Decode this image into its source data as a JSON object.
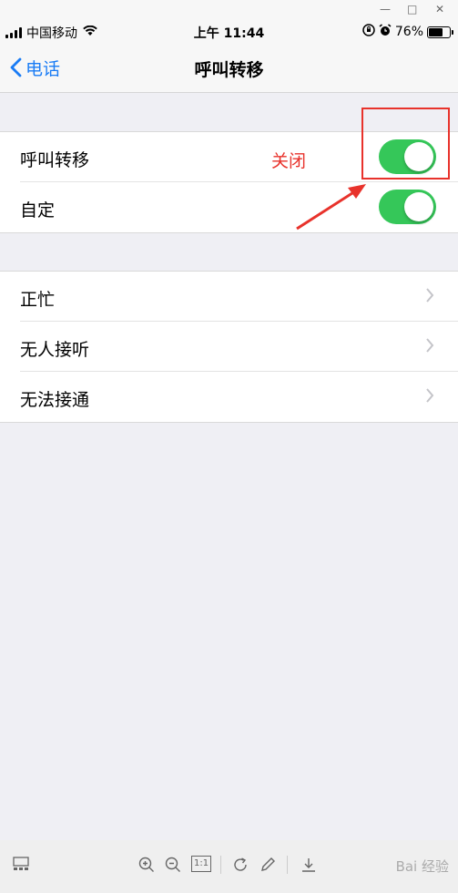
{
  "status_bar": {
    "carrier": "中国移动",
    "time": "上午 11:44",
    "battery": "76%",
    "battery_level": 0.76
  },
  "nav": {
    "back_label": "电话",
    "title": "呼叫转移"
  },
  "group1": {
    "rows": [
      {
        "label": "呼叫转移",
        "toggle_on": true
      },
      {
        "label": "自定",
        "toggle_on": true
      }
    ]
  },
  "group2": {
    "rows": [
      {
        "label": "正忙"
      },
      {
        "label": "无人接听"
      },
      {
        "label": "无法接通"
      }
    ]
  },
  "annotation": {
    "text": "关闭",
    "color": "#e8322b"
  },
  "toggle_color": "#35c759",
  "link_color": "#1a7cf5",
  "toolbar": {
    "icons": [
      "thumbnails-icon",
      "zoom-in-icon",
      "zoom-out-icon",
      "actual-size-icon",
      "rotate-icon",
      "edit-icon",
      "download-icon"
    ],
    "actual_size_label": "1:1"
  },
  "watermark": "Bai 经验"
}
